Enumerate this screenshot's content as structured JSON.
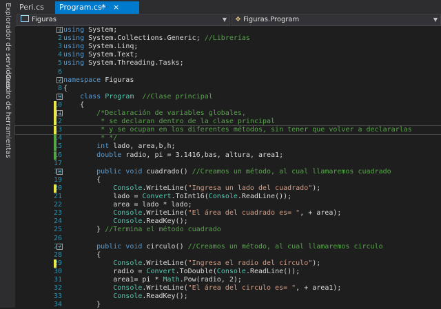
{
  "side_panel": {
    "tabs": [
      "Explorador de servidores",
      "Cuadro de herramientas"
    ]
  },
  "tabs": [
    {
      "label": "Peri.cs"
    },
    {
      "label": "Program.cs*",
      "pin": "⊹",
      "close": "×"
    }
  ],
  "nav": {
    "left": "Figuras",
    "right": "Figuras.Program"
  },
  "colors": {
    "keyword": "#569cd6",
    "type": "#4ec9b0",
    "comment": "#57a64a",
    "string": "#d69d85",
    "linenum": "#2b91af",
    "changed_yellow": "#e8e84a",
    "changed_green": "#57a64a"
  },
  "lines": [
    {
      "n": "1",
      "fold": "−",
      "mark": "",
      "segs": [
        [
          "kw",
          "using"
        ],
        [
          "",
          "System;"
        ]
      ]
    },
    {
      "n": "2",
      "fold": "",
      "mark": "",
      "segs": [
        [
          "kw",
          "using"
        ],
        [
          "",
          "System.Collections.Generic; "
        ],
        [
          "cm",
          "//Librerías"
        ]
      ]
    },
    {
      "n": "3",
      "fold": "",
      "mark": "",
      "segs": [
        [
          "kw",
          "using"
        ],
        [
          "",
          "System.Linq;"
        ]
      ]
    },
    {
      "n": "4",
      "fold": "",
      "mark": "",
      "segs": [
        [
          "kw",
          "using"
        ],
        [
          "",
          "System.Text;"
        ]
      ]
    },
    {
      "n": "5",
      "fold": "",
      "mark": "",
      "segs": [
        [
          "kw",
          "using"
        ],
        [
          "",
          "System.Threading.Tasks;"
        ]
      ]
    },
    {
      "n": "6",
      "fold": "",
      "mark": "",
      "segs": []
    },
    {
      "n": "7",
      "fold": "−",
      "mark": "",
      "segs": [
        [
          "kw",
          "namespace"
        ],
        [
          "",
          "Figuras"
        ]
      ]
    },
    {
      "n": "8",
      "fold": "",
      "mark": "",
      "segs": [
        [
          "",
          "{"
        ]
      ]
    },
    {
      "n": "9",
      "fold": "−",
      "mark": "",
      "segs": [
        [
          "kw",
          "    class"
        ],
        [
          "ty",
          "Program"
        ],
        [
          "cm",
          "  //Clase principal"
        ]
      ]
    },
    {
      "n": "10",
      "fold": "",
      "mark": "yellow",
      "segs": [
        [
          "",
          "    {"
        ]
      ]
    },
    {
      "n": "11",
      "fold": "−",
      "mark": "yellow",
      "segs": [
        [
          "cm",
          "        /*Declaración de variables globales,"
        ]
      ]
    },
    {
      "n": "12",
      "fold": "",
      "mark": "yellow",
      "segs": [
        [
          "cm",
          "         * se declaran dentro de la clase principal"
        ]
      ]
    },
    {
      "n": "13",
      "fold": "",
      "mark": "yellow",
      "segs": [
        [
          "cm",
          "         * y se ocupan en los diferentes métodos, sin tener que volver a declararlas"
        ]
      ]
    },
    {
      "n": "14",
      "fold": "",
      "mark": "green",
      "segs": [
        [
          "cm",
          "         * */"
        ]
      ]
    },
    {
      "n": "15",
      "fold": "",
      "mark": "green",
      "segs": [
        [
          "kw",
          "        int"
        ],
        [
          "",
          "lado, area,b,h;"
        ]
      ]
    },
    {
      "n": "16",
      "fold": "",
      "mark": "green",
      "segs": [
        [
          "kw",
          "        double"
        ],
        [
          "",
          "radio, pi = 3.1416,bas, altura, area1;"
        ]
      ]
    },
    {
      "n": "17",
      "fold": "",
      "mark": "",
      "segs": []
    },
    {
      "n": "18",
      "fold": "−",
      "mark": "",
      "segs": [
        [
          "kw",
          "        public void"
        ],
        [
          "",
          "cuadrado() "
        ],
        [
          "cm",
          "//Creamos un método, al cual llamaremos cuadrado"
        ]
      ]
    },
    {
      "n": "19",
      "fold": "",
      "mark": "",
      "segs": [
        [
          "",
          "        {"
        ]
      ]
    },
    {
      "n": "20",
      "fold": "",
      "mark": "yellow",
      "segs": [
        [
          "ty",
          "            Console"
        ],
        [
          "",
          ".WriteLine("
        ],
        [
          "st",
          "\"Ingresa un lado del cuadrado\""
        ],
        [
          "",
          ");"
        ]
      ]
    },
    {
      "n": "21",
      "fold": "",
      "mark": "",
      "segs": [
        [
          "",
          "            lado = "
        ],
        [
          "ty",
          "Convert"
        ],
        [
          "",
          ".ToInt16("
        ],
        [
          "ty",
          "Console"
        ],
        [
          "",
          ".ReadLine());"
        ]
      ]
    },
    {
      "n": "22",
      "fold": "",
      "mark": "",
      "segs": [
        [
          "",
          "            area = lado * lado;"
        ]
      ]
    },
    {
      "n": "23",
      "fold": "",
      "mark": "",
      "segs": [
        [
          "ty",
          "            Console"
        ],
        [
          "",
          ".WriteLine("
        ],
        [
          "st",
          "\"El área del cuadrado es= \""
        ],
        [
          "",
          ", + area);"
        ]
      ]
    },
    {
      "n": "24",
      "fold": "",
      "mark": "",
      "segs": [
        [
          "ty",
          "            Console"
        ],
        [
          "",
          ".ReadKey();"
        ]
      ]
    },
    {
      "n": "25",
      "fold": "",
      "mark": "",
      "segs": [
        [
          "",
          "        } "
        ],
        [
          "cm",
          "//Termina el método cuadrado"
        ]
      ]
    },
    {
      "n": "26",
      "fold": "",
      "mark": "",
      "segs": []
    },
    {
      "n": "27",
      "fold": "−",
      "mark": "",
      "segs": [
        [
          "kw",
          "        public void"
        ],
        [
          "",
          "circulo() "
        ],
        [
          "cm",
          "//Creamos un método, al cual llamaremos circulo"
        ]
      ]
    },
    {
      "n": "28",
      "fold": "",
      "mark": "",
      "segs": [
        [
          "",
          "        {"
        ]
      ]
    },
    {
      "n": "29",
      "fold": "",
      "mark": "yellow",
      "segs": [
        [
          "ty",
          "            Console"
        ],
        [
          "",
          ".WriteLine("
        ],
        [
          "st",
          "\"Ingresa el radio del círculo\""
        ],
        [
          "",
          ");"
        ]
      ]
    },
    {
      "n": "30",
      "fold": "",
      "mark": "",
      "segs": [
        [
          "",
          "            radio = "
        ],
        [
          "ty",
          "Convert"
        ],
        [
          "",
          ".ToDouble("
        ],
        [
          "ty",
          "Console"
        ],
        [
          "",
          ".ReadLine());"
        ]
      ]
    },
    {
      "n": "31",
      "fold": "",
      "mark": "",
      "segs": [
        [
          "",
          "            area1= pi * "
        ],
        [
          "ty",
          "Math"
        ],
        [
          "",
          ".Pow(radio, 2);"
        ]
      ]
    },
    {
      "n": "32",
      "fold": "",
      "mark": "",
      "segs": [
        [
          "ty",
          "            Console"
        ],
        [
          "",
          ".WriteLine("
        ],
        [
          "st",
          "\"El área del circulo es= \""
        ],
        [
          "",
          ", + area1);"
        ]
      ]
    },
    {
      "n": "33",
      "fold": "",
      "mark": "",
      "segs": [
        [
          "ty",
          "            Console"
        ],
        [
          "",
          ".ReadKey();"
        ]
      ]
    },
    {
      "n": "34",
      "fold": "",
      "mark": "",
      "segs": [
        [
          "",
          "        }"
        ]
      ]
    }
  ]
}
